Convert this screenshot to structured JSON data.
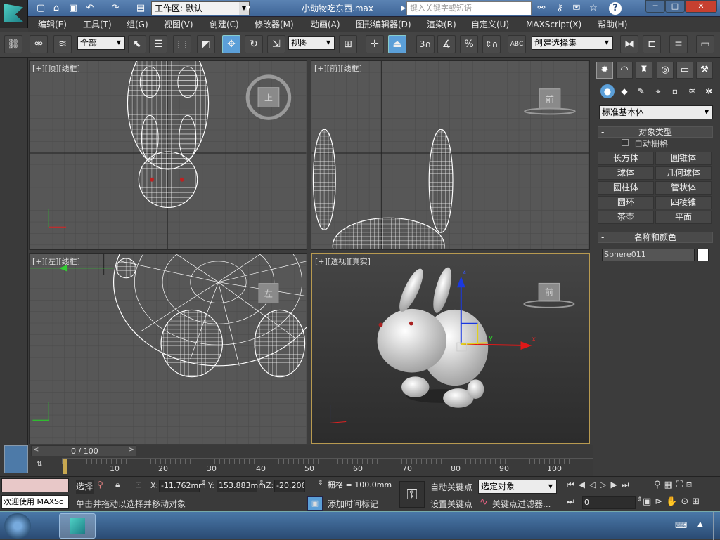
{
  "titlebar": {
    "workspace": "工作区: 默认",
    "filename": "小动物吃东西.max",
    "search_placeholder": "键入关键字或短语",
    "help": "?",
    "min": "─",
    "max": "□",
    "close": "✕"
  },
  "menu": [
    "编辑(E)",
    "工具(T)",
    "组(G)",
    "视图(V)",
    "创建(C)",
    "修改器(M)",
    "动画(A)",
    "图形编辑器(D)",
    "渲染(R)",
    "自定义(U)",
    "MAXScript(X)",
    "帮助(H)"
  ],
  "toolbar": {
    "selection_filter": "全部",
    "coord_system": "视图",
    "snap_3": "3",
    "snap_2": "2",
    "named_selection": "创建选择集",
    "abc": "ABC"
  },
  "viewports": {
    "top": {
      "label": "[+][顶][线框]",
      "cube": "上"
    },
    "front": {
      "label": "[+][前][线框]",
      "cube": "前"
    },
    "left": {
      "label": "[+][左][线框]",
      "cube": "左"
    },
    "persp": {
      "label": "[+][透视][真实]",
      "cube": "前",
      "axis_x": "x",
      "axis_y": "y",
      "axis_z": "z"
    }
  },
  "command_panel": {
    "category": "标准基本体",
    "object_type_title": "对象类型",
    "auto_grid": "自动栅格",
    "buttons": [
      "长方体",
      "圆锥体",
      "球体",
      "几何球体",
      "圆柱体",
      "管状体",
      "圆环",
      "四棱锥",
      "茶壶",
      "平面"
    ],
    "name_color_title": "名称和颜色",
    "object_name": "Sphere011"
  },
  "timeline": {
    "frame": "0 / 100",
    "ticks": [
      "10",
      "20",
      "30",
      "40",
      "50",
      "60",
      "70",
      "80",
      "90",
      "100"
    ]
  },
  "status": {
    "welcome": "欢迎使用 MAXSc",
    "select_label": "选择",
    "x_label": "X:",
    "x": "-11.762mm",
    "y_label": "Y:",
    "y": "153.883mm",
    "z_label": "Z:",
    "z": "-20.206mm",
    "grid": "栅格 = 100.0mm",
    "hint": "单击并拖动以选择并移动对象",
    "add_time_tag": "添加时间标记",
    "auto_key": "自动关键点",
    "set_key": "设置关键点",
    "key_mode": "选定对象",
    "key_filter": "关键点过滤器...",
    "current_frame": "0"
  }
}
